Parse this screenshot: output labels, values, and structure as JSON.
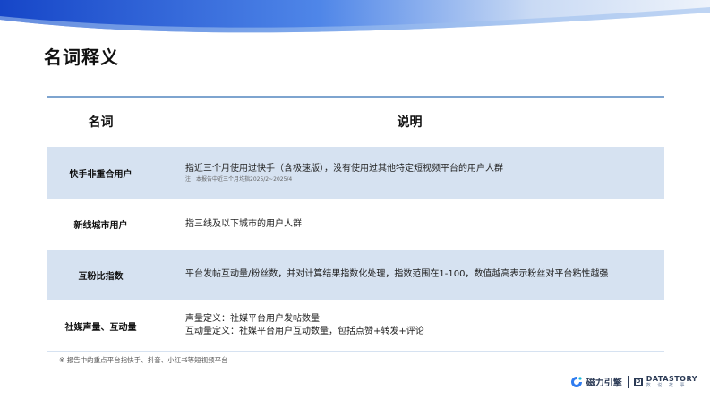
{
  "page": {
    "title": "名词释义"
  },
  "table": {
    "headers": {
      "term": "名词",
      "desc": "说明"
    },
    "rows": [
      {
        "term": "快手非重合用户",
        "lines": [
          "指近三个月使用过快手（含极速版），没有使用过其他特定短视频平台的用户人群"
        ],
        "note": "注：本报告中近三个月均指2025/2~2025/4"
      },
      {
        "term": "新线城市用户",
        "lines": [
          "指三线及以下城市的用户人群"
        ]
      },
      {
        "term": "互粉比指数",
        "lines": [
          "平台发帖互动量/粉丝数，并对计算结果指数化处理，指数范围在1-100，数值越高表示粉丝对平台粘性越强"
        ]
      },
      {
        "term": "社媒声量、互动量",
        "lines": [
          "声量定义：社媒平台用户发帖数量",
          "互动量定义：社媒平台用户互动数量，包括点赞+转发+评论"
        ]
      }
    ]
  },
  "footnote": "※ 报告中的重点平台指快手、抖音、小红书等短视频平台",
  "brand": {
    "name": "磁力引擎",
    "partner": "DATASTORY",
    "partner_sub": "数 说 故 事"
  },
  "colors": {
    "accent": "#1e5fd6",
    "row_shade": "#d6e2f1",
    "rule": "#7ea4cf"
  }
}
